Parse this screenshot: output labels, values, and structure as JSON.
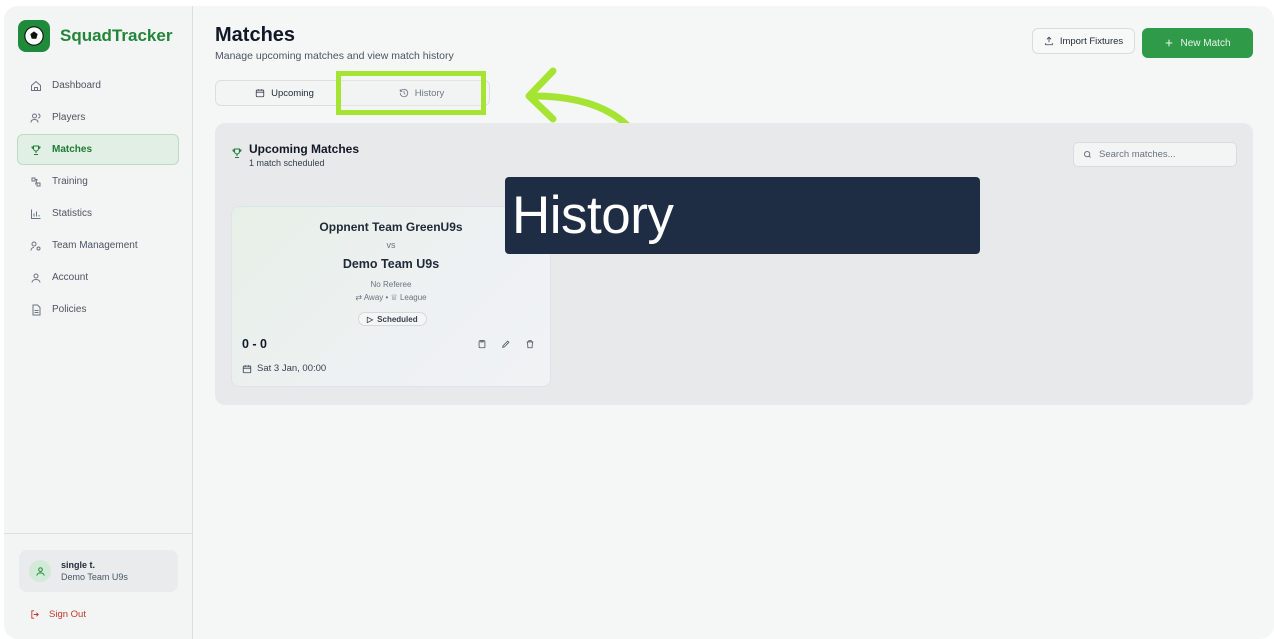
{
  "app": {
    "name": "SquadTracker",
    "brand_color": "#22863a"
  },
  "sidebar": {
    "items": [
      {
        "label": "Dashboard",
        "icon": "home-icon"
      },
      {
        "label": "Players",
        "icon": "users-icon"
      },
      {
        "label": "Matches",
        "icon": "trophy-icon",
        "active": true
      },
      {
        "label": "Training",
        "icon": "training-icon"
      },
      {
        "label": "Statistics",
        "icon": "bar-chart-icon"
      },
      {
        "label": "Team Management",
        "icon": "team-icon"
      },
      {
        "label": "Account",
        "icon": "user-icon"
      },
      {
        "label": "Policies",
        "icon": "document-icon"
      }
    ],
    "user": {
      "name": "single t.",
      "team": "Demo Team U9s"
    },
    "sign_out": "Sign Out"
  },
  "header": {
    "title": "Matches",
    "subtitle": "Manage upcoming matches and view match history",
    "import_label": "Import Fixtures",
    "new_match_label": "New Match"
  },
  "tabs": {
    "upcoming": "Upcoming",
    "history": "History"
  },
  "panel": {
    "title": "Upcoming Matches",
    "subtitle": "1 match scheduled",
    "search_placeholder": "Search matches..."
  },
  "match": {
    "opponent": "Oppnent Team GreenU9s",
    "vs": "vs",
    "home_team": "Demo Team U9s",
    "referee": "No Referee",
    "venue": "Away",
    "competition": "League",
    "status": "Scheduled",
    "score": "0 - 0",
    "date": "Sat 3 Jan, 00:00"
  },
  "annotation": {
    "tooltip": "History",
    "highlight_color": "#a6e433"
  }
}
